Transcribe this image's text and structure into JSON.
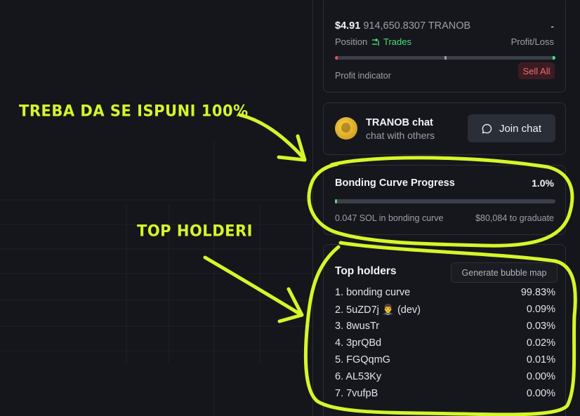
{
  "position": {
    "value": "$4.91",
    "amount": "914,650.8307 TRANOB",
    "pnl": "-",
    "tab_position": "Position",
    "tab_trades": "Trades",
    "profit_loss_label": "Profit/Loss",
    "profit_indicator_label": "Profit indicator",
    "sell_all_label": "Sell All"
  },
  "chat": {
    "title": "TRANOB chat",
    "subtitle": "chat with others",
    "join_label": "Join chat"
  },
  "bonding": {
    "title": "Bonding Curve Progress",
    "percent_label": "1.0%",
    "progress": 0.01,
    "sol_label": "0.047 SOL in bonding curve",
    "graduate_label": "$80,084 to graduate"
  },
  "holders": {
    "title": "Top holders",
    "bubble_map_label": "Generate bubble map",
    "rows": [
      {
        "name": "1. bonding curve",
        "pct": "99.83%"
      },
      {
        "name": "2. 5uZD7j 🤵‍♂️ (dev)",
        "pct": "0.09%"
      },
      {
        "name": "3. 8wusTr",
        "pct": "0.03%"
      },
      {
        "name": "4. 3prQBd",
        "pct": "0.02%"
      },
      {
        "name": "5. FGQqmG",
        "pct": "0.01%"
      },
      {
        "name": "6. AL53Ky",
        "pct": "0.00%"
      },
      {
        "name": "7. 7vufpB",
        "pct": "0.00%"
      }
    ]
  },
  "annotations": {
    "bonding_note": "TREBA DA SE ISPUNI 100%",
    "holders_note": "TOP HOLDERI"
  },
  "colors": {
    "background": "#15161b",
    "accent_green": "#4ade80",
    "sell_red": "#f06a73",
    "annotation": "#d6f52a"
  }
}
